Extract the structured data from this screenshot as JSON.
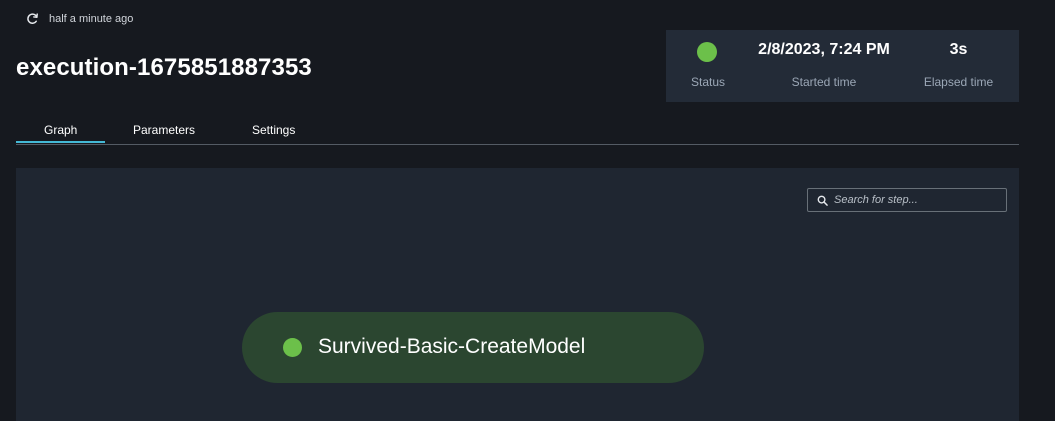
{
  "header": {
    "refresh_icon": "refresh-icon",
    "last_refreshed": "half a minute ago",
    "title": "execution-1675851887353"
  },
  "status_panel": {
    "status": {
      "label": "Status",
      "state": "succeeded",
      "color": "#6cc04a"
    },
    "started": {
      "value": "2/8/2023, 7:24 PM",
      "label": "Started time"
    },
    "elapsed": {
      "value": "3s",
      "label": "Elapsed time"
    }
  },
  "tabs": [
    {
      "label": "Graph",
      "active": true
    },
    {
      "label": "Parameters",
      "active": false
    },
    {
      "label": "Settings",
      "active": false
    }
  ],
  "graph": {
    "search": {
      "placeholder": "Search for step...",
      "value": "",
      "icon": "search-icon"
    },
    "nodes": [
      {
        "label": "Survived-Basic-CreateModel",
        "status": "succeeded",
        "color": "#6cc04a"
      }
    ]
  },
  "colors": {
    "accent": "#44b9d6",
    "success": "#6cc04a",
    "node_bg": "#2b4630",
    "page_bg": "#16191f",
    "panel_bg": "#232b37",
    "canvas_bg": "#1f2631"
  }
}
